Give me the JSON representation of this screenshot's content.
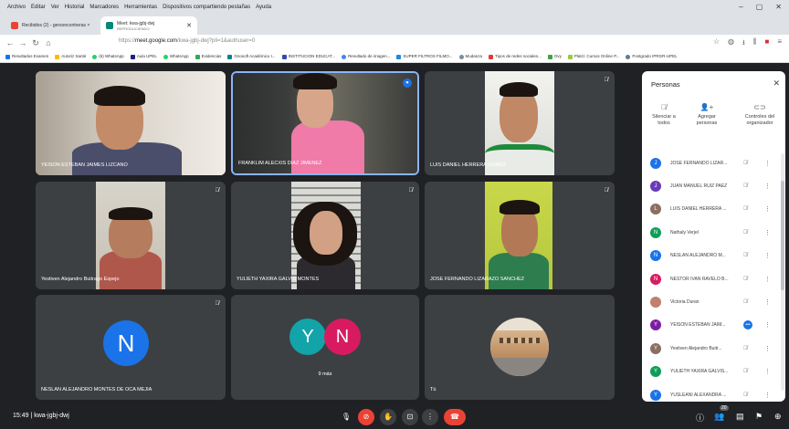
{
  "browser": {
    "menu": [
      "Archivo",
      "Editar",
      "Ver",
      "Historial",
      "Marcadores",
      "Herramientas",
      "Dispositivos compartiendo pestañas",
      "Ayuda"
    ],
    "tabs": [
      {
        "label": "Recibidos (2) - gersoncontreras ×"
      },
      {
        "label": "Meet: kwa-jgbj-dwj",
        "sub": "REPRODUCIENDO"
      }
    ],
    "url_host": "meet.google.com",
    "url_rest": "/kwa-jgbj-dwj?pli=1&authuser=0",
    "url_prefix": "https://",
    "bookmarks": [
      "Resultados Examen",
      "Autoriz Santé",
      "(6) WhatsApp",
      "Aula UPEL",
      "WhatsApp",
      "Evidencias",
      "Gnosoft Académico I...",
      "INSTITUCION EDUCAT...",
      "Resultado de imagen...",
      "SUPER FILTROS FILMO...",
      "Mudanza",
      "Tipos de redes sociales...",
      "Ovy",
      "Platzi: Cursos Online P...",
      "Postgrado IPRGR-UPEL"
    ]
  },
  "tiles": [
    {
      "name": "YEISON ESTEBAN JAIMES LIZCANO"
    },
    {
      "name": "FRANKLIM ALECXIS DIAZ JIMENEZ"
    },
    {
      "name": "LUIS DANIEL HERRERA GOMEZ"
    },
    {
      "name": "Yestiven Alejandro Buitrago Espejo"
    },
    {
      "name": "YULIETH YAXIRA GALVIS MONTES"
    },
    {
      "name": "JOSE FERNANDO LIZARAZO SANCHEZ"
    },
    {
      "name": "NESLAN ALEJANDRO MONTES DE OCA MEJIA",
      "initial": "N"
    },
    {
      "name": "9 más",
      "initials": [
        "Y",
        "N"
      ]
    },
    {
      "name": "Tú"
    }
  ],
  "bottom": {
    "time": "15:49",
    "meeting_code": "kwa-jgbj-dwj",
    "participants_badge": "20"
  },
  "panel": {
    "title": "Personas",
    "actions": [
      {
        "line1": "Silenciar a",
        "line2": "todos"
      },
      {
        "line1": "Agregar",
        "line2": "personas"
      },
      {
        "line1": "Controles del",
        "line2": "organizador"
      }
    ],
    "people": [
      {
        "initial": "J",
        "name": "JOSE FERNANDO LIZAR...",
        "color": "#1a73e8"
      },
      {
        "initial": "J",
        "name": "JUAN MANUEL RUIZ PAEZ",
        "color": "#673ab7"
      },
      {
        "initial": "L",
        "name": "LUIS DANIEL HERRERA ...",
        "color": "#8d6e63"
      },
      {
        "initial": "N",
        "name": "Nathaly Verjel",
        "color": "#0f9d58"
      },
      {
        "initial": "N",
        "name": "NESLAN ALEJANDRO M...",
        "color": "#1a73e8"
      },
      {
        "initial": "N",
        "name": "NESTOR IVAN RAVELO B...",
        "color": "#d81b60"
      },
      {
        "initial": "",
        "name": "Victoria Duran",
        "color": "#c08070"
      },
      {
        "initial": "Y",
        "name": "YEISON ESTEBAN JAIM...",
        "color": "#7b1fa2"
      },
      {
        "initial": "Y",
        "name": "Yestiven Alejandro Buitr...",
        "color": "#8d6e63"
      },
      {
        "initial": "Y",
        "name": "YULIETH YAXIRA GALVIS...",
        "color": "#0f9d58"
      },
      {
        "initial": "Y",
        "name": "YUSLEANI ALEXANDRA ...",
        "color": "#1a73e8"
      }
    ]
  }
}
